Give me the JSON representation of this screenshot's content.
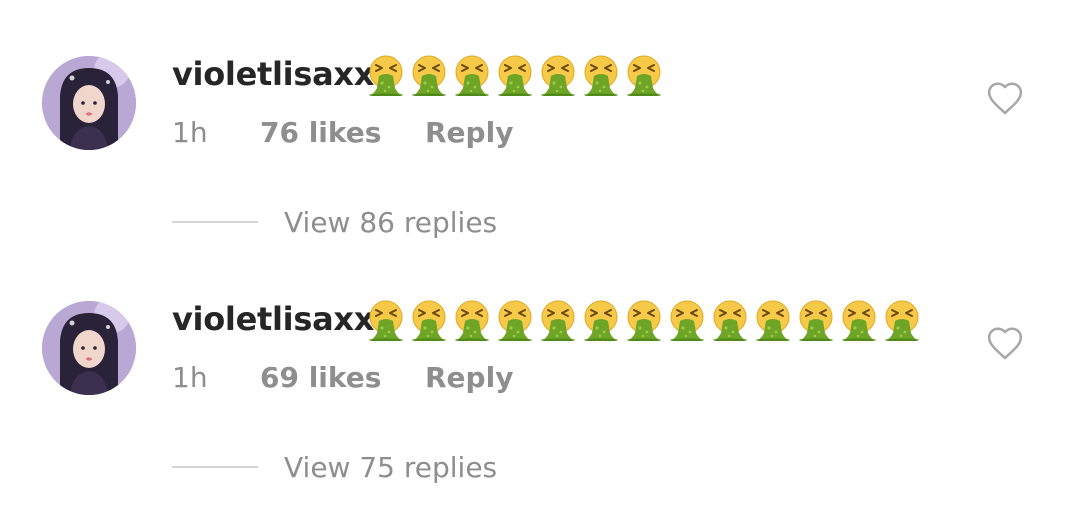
{
  "comments": [
    {
      "username": "violetlisaxx",
      "emoji": "nauseated-vomiting-face",
      "emoji_count": 7,
      "time": "1h",
      "likes": "76 likes",
      "reply_label": "Reply",
      "replies_label": "View 86 replies"
    },
    {
      "username": "violetlisaxx",
      "emoji": "nauseated-vomiting-face",
      "emoji_count": 13,
      "time": "1h",
      "likes": "69 likes",
      "reply_label": "Reply",
      "replies_label": "View 75 replies"
    }
  ],
  "icons": {
    "like": "heart-outline-icon",
    "emoji": "vomiting-face-emoji"
  },
  "colors": {
    "username": "#262626",
    "meta": "#8e8e8e",
    "divider": "#d5d5d5",
    "heart": "#a8a8a8",
    "emoji_face": "#f7c948",
    "emoji_vomit": "#6fa526"
  }
}
